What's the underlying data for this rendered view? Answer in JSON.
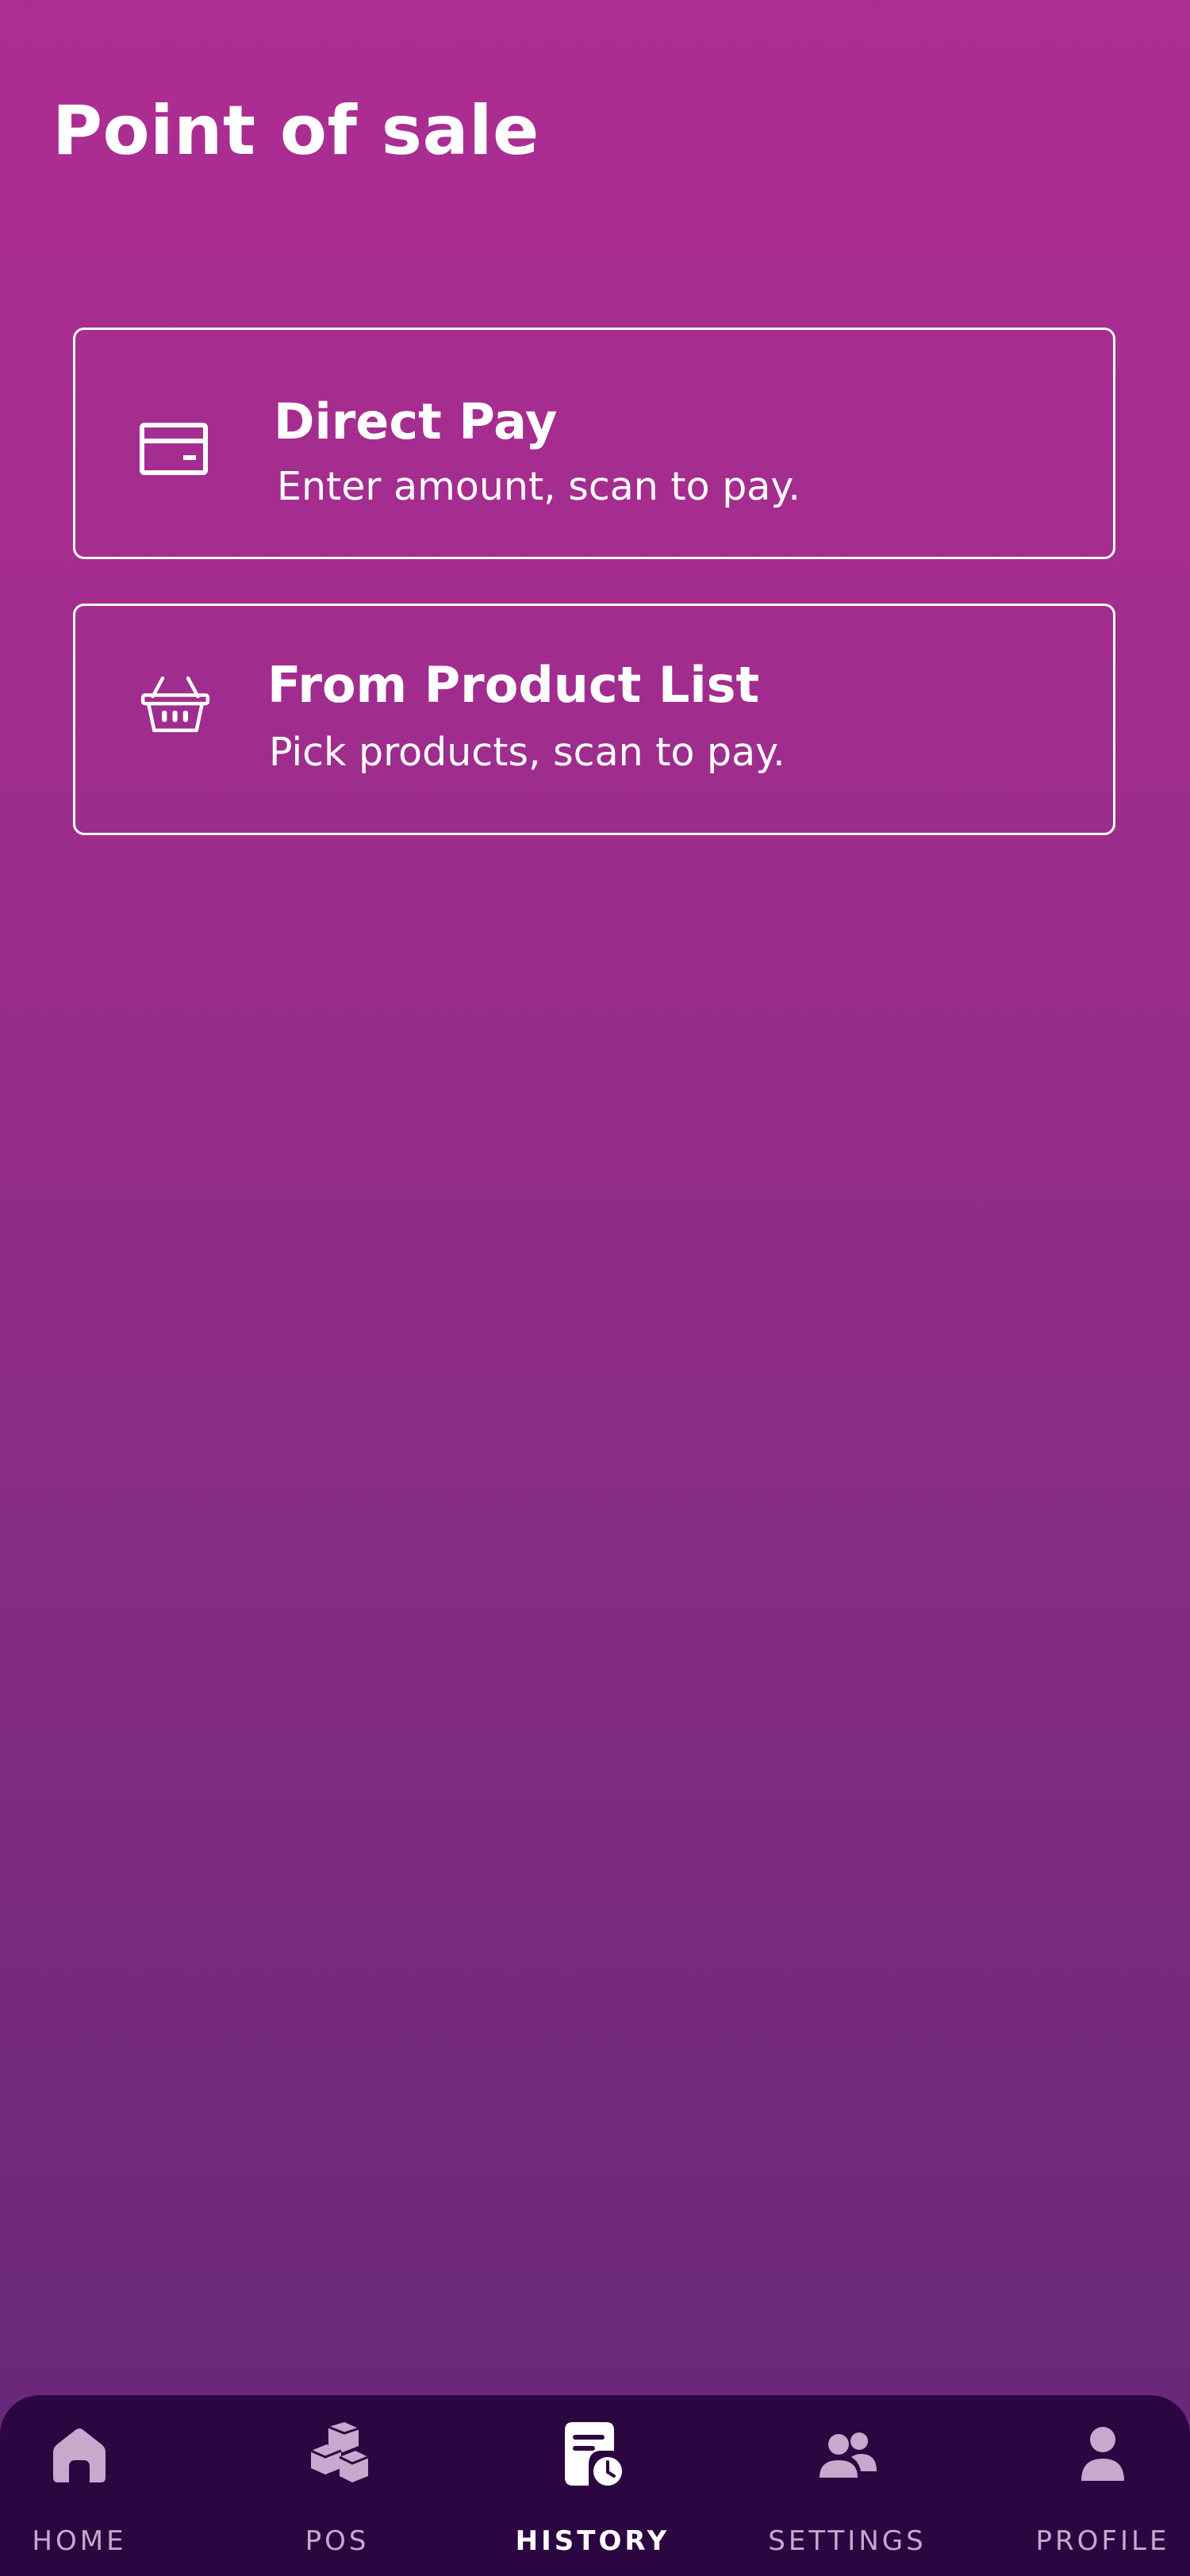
{
  "header": {
    "title": "Point of sale"
  },
  "options": [
    {
      "title": "Direct Pay",
      "subtitle": "Enter amount, scan to pay.",
      "icon": "credit-card-icon"
    },
    {
      "title": "From Product List",
      "subtitle": "Pick products, scan to pay.",
      "icon": "basket-icon"
    }
  ],
  "nav": {
    "items": [
      {
        "label": "HOME",
        "icon": "home-icon"
      },
      {
        "label": "POS",
        "icon": "boxes-icon"
      },
      {
        "label": "HISTORY",
        "icon": "history-icon",
        "active": true
      },
      {
        "label": "SETTINGS",
        "icon": "users-icon"
      },
      {
        "label": "PROFILE",
        "icon": "person-icon"
      }
    ]
  },
  "colors": {
    "background_top": "#ad2d93",
    "background_bottom": "#67287a",
    "nav_background": "#2c0641",
    "nav_inactive": "#c6a9cc",
    "nav_active": "#ffffff"
  }
}
